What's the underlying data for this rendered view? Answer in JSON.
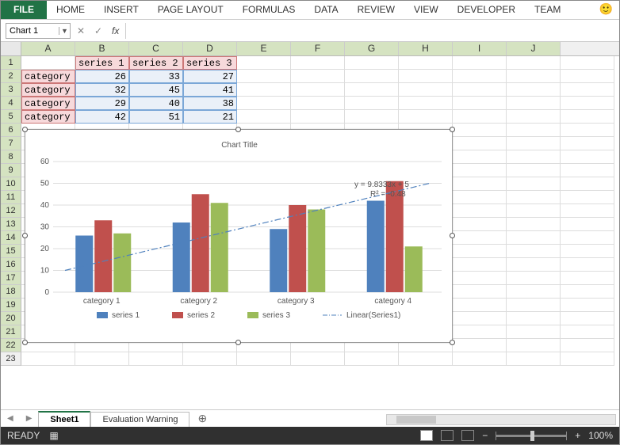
{
  "ribbon": {
    "file": "FILE",
    "tabs": [
      "HOME",
      "INSERT",
      "PAGE LAYOUT",
      "FORMULAS",
      "DATA",
      "REVIEW",
      "VIEW",
      "DEVELOPER",
      "TEAM"
    ]
  },
  "namebox": {
    "value": "Chart 1"
  },
  "fx": {
    "label": "fx"
  },
  "columns": [
    "A",
    "B",
    "C",
    "D",
    "E",
    "F",
    "G",
    "H",
    "I",
    "J"
  ],
  "series_headers": [
    "series 1",
    "series 2",
    "series 3"
  ],
  "categories": [
    "category 1",
    "category 2",
    "category 3",
    "category 4"
  ],
  "table": [
    [
      26,
      33,
      27
    ],
    [
      32,
      45,
      41
    ],
    [
      29,
      40,
      38
    ],
    [
      42,
      51,
      21
    ]
  ],
  "chart": {
    "title": "Chart Title",
    "trend_eq": "y = 9.8333x + 5",
    "trend_r2": "R² = -0.48",
    "legend": {
      "s1": "series 1",
      "s2": "series 2",
      "s3": "series 3",
      "tl": "Linear(Series1)"
    },
    "y_ticks": [
      0,
      10,
      20,
      30,
      40,
      50,
      60
    ]
  },
  "chart_data": {
    "type": "bar",
    "title": "Chart Title",
    "categories": [
      "category 1",
      "category 2",
      "category 3",
      "category 4"
    ],
    "series": [
      {
        "name": "series 1",
        "values": [
          26,
          32,
          29,
          42
        ],
        "color": "#4f81bd"
      },
      {
        "name": "series 2",
        "values": [
          33,
          45,
          40,
          51
        ],
        "color": "#c0504d"
      },
      {
        "name": "series 3",
        "values": [
          27,
          41,
          38,
          21
        ],
        "color": "#9bbb59"
      }
    ],
    "trendline": {
      "name": "Linear(Series1)",
      "equation": "y = 9.8333x + 5",
      "r2": "R² = -0.48"
    },
    "ylim": [
      0,
      60
    ],
    "xlabel": "",
    "ylabel": ""
  },
  "sheets": {
    "active": "Sheet1",
    "warn": "Evaluation Warning"
  },
  "status": {
    "ready": "READY",
    "zoom": "100%"
  }
}
